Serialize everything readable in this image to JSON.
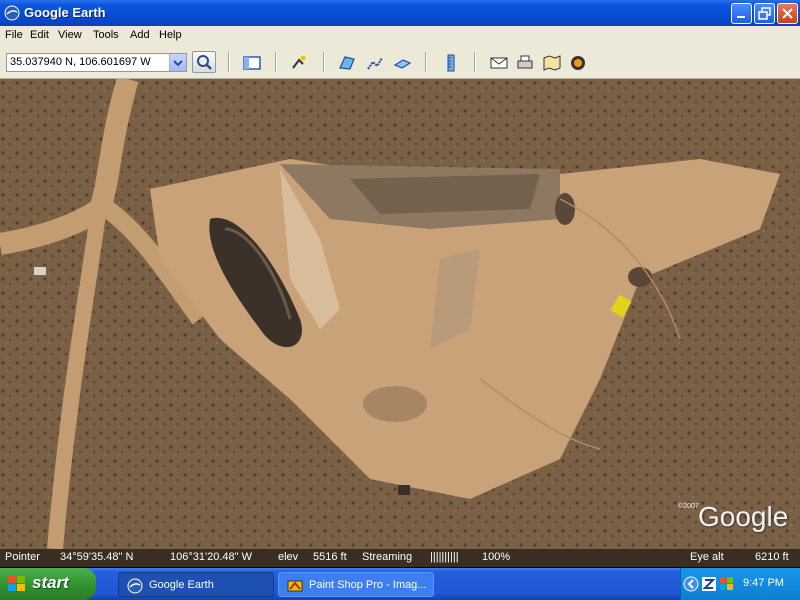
{
  "window": {
    "title": "Google Earth",
    "controls": [
      "minimize-icon",
      "maximize-icon",
      "close-icon"
    ]
  },
  "menu": {
    "items": [
      "File",
      "Edit",
      "View",
      "Tools",
      "Add",
      "Help"
    ]
  },
  "toolbar": {
    "coordinates_value": "35.037940 N, 106.601697 W",
    "search_icon": "search-icon",
    "icons": [
      "sidebar-icon",
      "placemark-icon",
      "polygon-icon",
      "path-icon",
      "image-overlay-icon",
      "ruler-icon",
      "email-icon",
      "print-icon",
      "maps-icon",
      "sky-icon"
    ]
  },
  "map": {
    "watermark": "Google",
    "copyright": "©2007"
  },
  "status": {
    "pointer_label": "Pointer",
    "lat": "34°59'35.48\" N",
    "lon": "106°31'20.48\" W",
    "elev_label": "elev",
    "elev_value": "5516 ft",
    "streaming_label": "Streaming",
    "streaming_bars": "||||||||||",
    "streaming_pct": "100%",
    "eye_alt_label": "Eye alt",
    "eye_alt_value": "6210 ft"
  },
  "taskbar": {
    "start_label": "start",
    "tasks": [
      {
        "label": "Google Earth",
        "active": true
      },
      {
        "label": "Paint Shop Pro - Imag...",
        "active": false
      }
    ],
    "clock": "9:47 PM"
  },
  "colors": {
    "title_blue": "#0a49cf",
    "chrome_beige": "#ece9d8",
    "taskbar_blue": "#245edb",
    "start_green": "#2f8f2f",
    "terrain_brown": "#7d6449",
    "dirt_tan": "#c9a27a"
  }
}
